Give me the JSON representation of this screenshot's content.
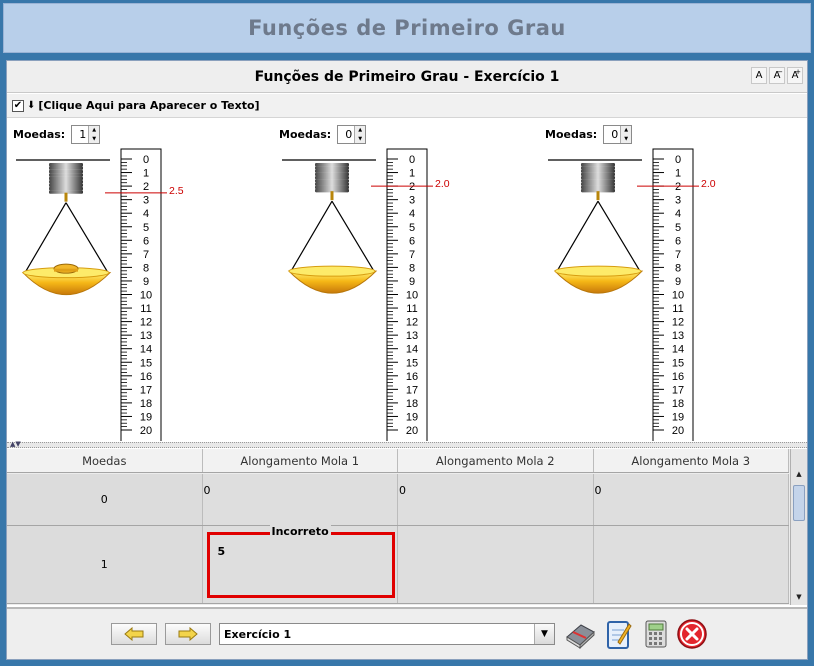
{
  "app": {
    "title": "Funções de Primeiro Grau"
  },
  "exercise_header": {
    "title": "Funções de Primeiro Grau - Exercício 1",
    "font_small": "A",
    "font_decrease": "A",
    "font_increase": "A",
    "font_increase_sup": "+",
    "font_decrease_sup": "−"
  },
  "toggle": {
    "checkbox_mark": "✔",
    "arrow": "⬇",
    "label": "[Clique Aqui para Aparecer o Texto]"
  },
  "stations": [
    {
      "moedas_label": "Moedas:",
      "moedas_value": "1",
      "reading": "2.5",
      "coins": 1
    },
    {
      "moedas_label": "Moedas:",
      "moedas_value": "0",
      "reading": "2.0",
      "coins": 0
    },
    {
      "moedas_label": "Moedas:",
      "moedas_value": "0",
      "reading": "2.0",
      "coins": 0
    }
  ],
  "ruler": {
    "ticks": [
      "0",
      "1",
      "2",
      "3",
      "4",
      "5",
      "6",
      "7",
      "8",
      "9",
      "10",
      "11",
      "12",
      "13",
      "14",
      "15",
      "16",
      "17",
      "18",
      "19",
      "20"
    ]
  },
  "table": {
    "headers": [
      "Moedas",
      "Alongamento Mola 1",
      "Alongamento Mola 2",
      "Alongamento Mola 3"
    ],
    "rows": [
      {
        "moedas": "0",
        "mola1": "0",
        "mola2": "0",
        "mola3": "0"
      },
      {
        "moedas": "1",
        "mola1": "5",
        "mola2": "",
        "mola3": ""
      }
    ],
    "feedback_label": "Incorreto"
  },
  "footer": {
    "select_value": "Exercício 1"
  },
  "colors": {
    "accent_red": "#e00000",
    "reading_red": "#cc0000",
    "title_bar": "#b8cfea",
    "frame": "#3877aa"
  }
}
